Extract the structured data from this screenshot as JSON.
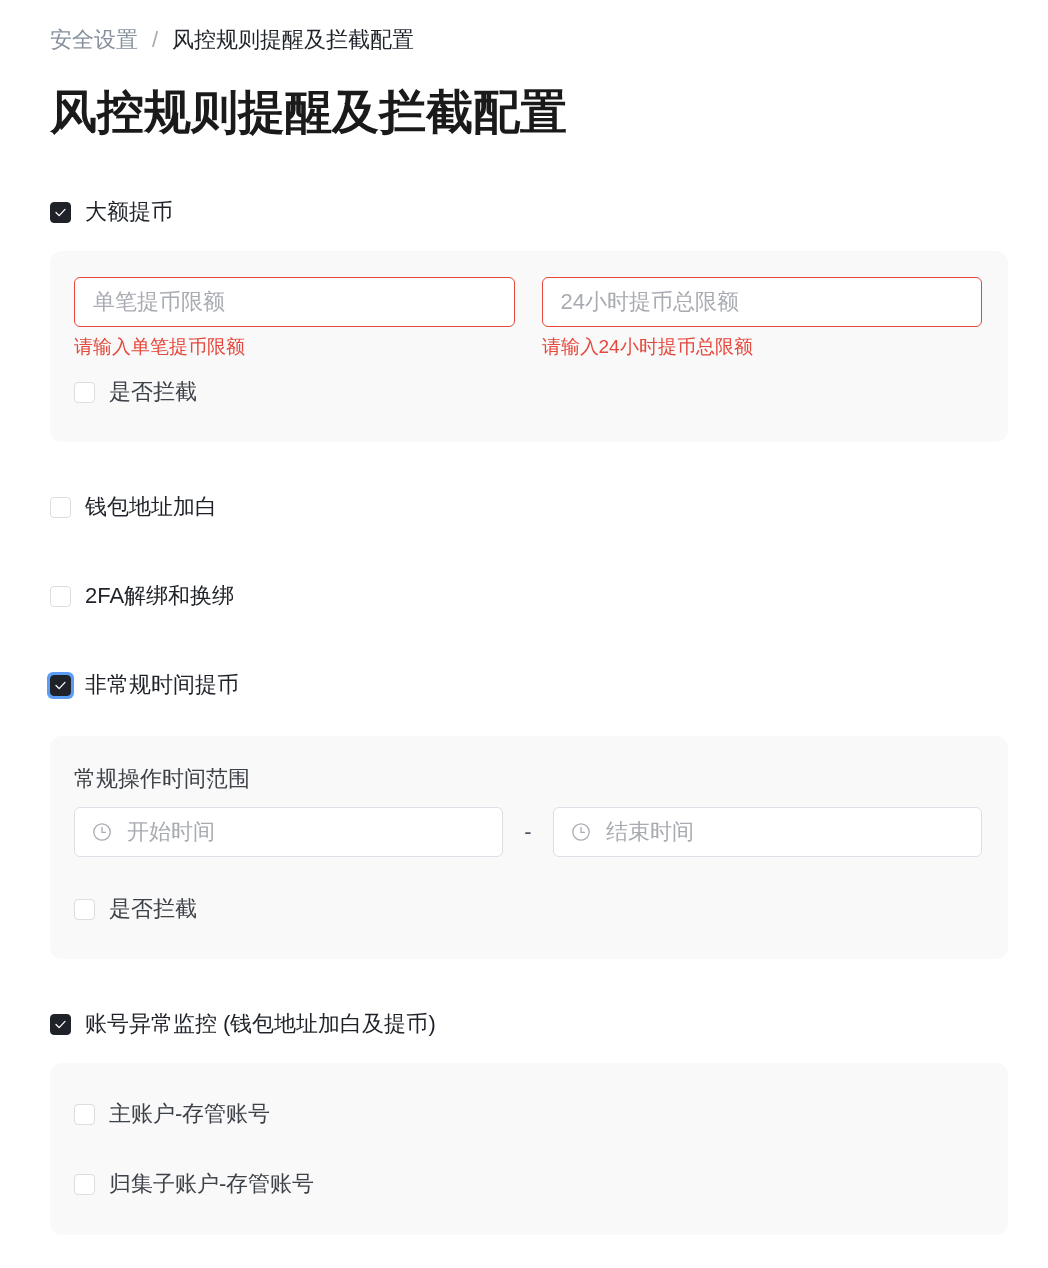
{
  "breadcrumb": {
    "separator": "/",
    "items": [
      {
        "label": "安全设置",
        "current": false
      },
      {
        "label": "风控规则提醒及拦截配置",
        "current": true
      }
    ]
  },
  "title": "风控规则提醒及拦截配置",
  "rules": [
    {
      "label": "大额提币",
      "checked": true,
      "focused": false,
      "panel": {
        "kind": "limits",
        "fields": [
          {
            "placeholder": "单笔提币限额",
            "error": "请输入单笔提币限额"
          },
          {
            "placeholder": "24小时提币总限额",
            "error": "请输入24小时提币总限额"
          }
        ],
        "intercept": {
          "label": "是否拦截",
          "checked": false
        }
      }
    },
    {
      "label": "钱包地址加白",
      "checked": false,
      "focused": false
    },
    {
      "label": "2FA解绑和换绑",
      "checked": false,
      "focused": false
    },
    {
      "label": "非常规时间提币",
      "checked": true,
      "focused": true,
      "panel": {
        "kind": "time_range",
        "label": "常规操作时间范围",
        "start": {
          "placeholder": "开始时间"
        },
        "separator": "-",
        "end": {
          "placeholder": "结束时间"
        },
        "intercept": {
          "label": "是否拦截",
          "checked": false
        }
      }
    },
    {
      "label": "账号异常监控 (钱包地址加白及提币)",
      "checked": true,
      "focused": false,
      "panel": {
        "kind": "accounts",
        "options": [
          {
            "label": "主账户-存管账号",
            "checked": false
          },
          {
            "label": "归集子账户-存管账号",
            "checked": false
          }
        ]
      }
    }
  ]
}
